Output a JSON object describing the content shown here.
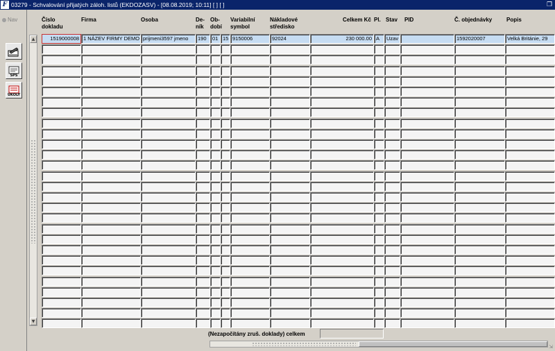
{
  "window": {
    "title": "03279 - Schvalování přijatých záloh. listů (EKDOZASV) - [08.08.2019; 10:11]  [ ]  [ ]",
    "app_icon_letter": "F"
  },
  "sidebar": {
    "nav_label": "Nav",
    "tools": [
      {
        "name": "approve-tool",
        "label": ""
      },
      {
        "name": "sps-tool",
        "label": "SPS"
      },
      {
        "name": "ukoly-tool",
        "label": "ÚKOLY"
      }
    ]
  },
  "table": {
    "columns": [
      {
        "key": "cislo",
        "line1": "Číslo",
        "line2": "dokladu"
      },
      {
        "key": "firma",
        "line1": "Firma",
        "line2": ""
      },
      {
        "key": "osoba",
        "line1": "Osoba",
        "line2": ""
      },
      {
        "key": "denik",
        "line1": "De-",
        "line2": "ník"
      },
      {
        "key": "obdobi",
        "line1": "Ob-",
        "line2": "dobí"
      },
      {
        "key": "c15",
        "line1": "",
        "line2": ""
      },
      {
        "key": "vs",
        "line1": "Variabilní",
        "line2": "symbol"
      },
      {
        "key": "ns",
        "line1": "Nákladové",
        "line2": "středisko"
      },
      {
        "key": "celkem",
        "line1": "Celkem Kč",
        "line2": ""
      },
      {
        "key": "pl",
        "line1": "Pl.",
        "line2": ""
      },
      {
        "key": "stav",
        "line1": "Stav",
        "line2": ""
      },
      {
        "key": "pid",
        "line1": "PID",
        "line2": ""
      },
      {
        "key": "objednavka",
        "line1": "Č. objednávky",
        "line2": ""
      },
      {
        "key": "popis",
        "line1": "Popis",
        "line2": ""
      }
    ],
    "rows": [
      [
        "1519000008",
        "1 NÁZEV FIRMY DEMO",
        "prijmeni3597 jmeno",
        "190",
        "01",
        "15",
        "9150006",
        "92024",
        "230 000.00",
        "A",
        "Uzav",
        "",
        "1592020007",
        "Velká Británie, 29"
      ]
    ],
    "empty_row_count": 27
  },
  "footer": {
    "label": "(Nezapočítány zruš. doklady) celkem",
    "total_value": ""
  }
}
